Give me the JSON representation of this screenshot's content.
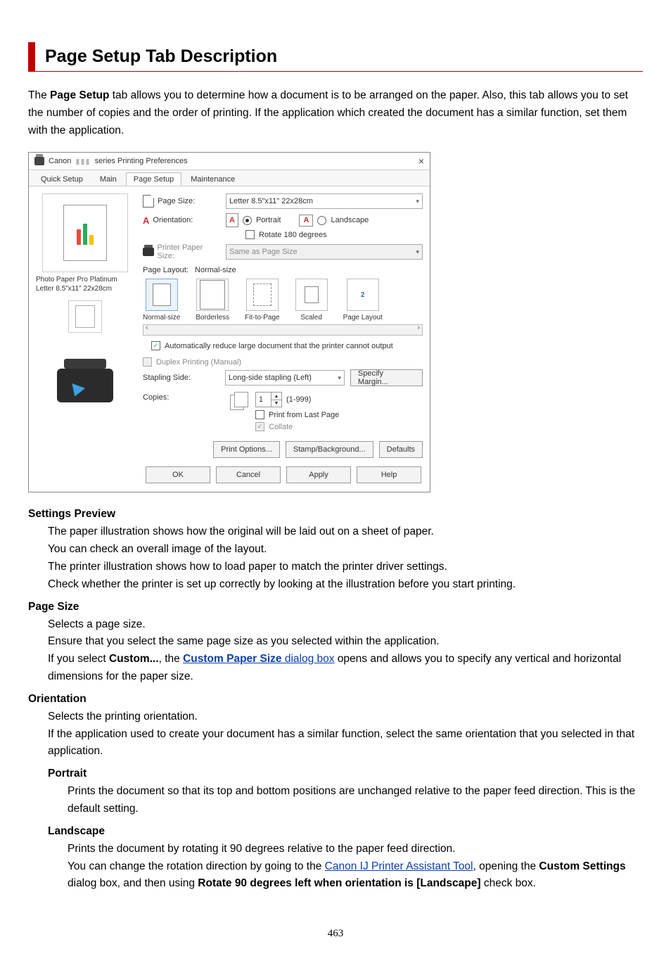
{
  "heading": "Page Setup Tab Description",
  "intro_prefix": "The ",
  "intro_bold": "Page Setup",
  "intro_rest": " tab allows you to determine how a document is to be arranged on the paper. Also, this tab allows you to set the number of copies and the order of printing. If the application which created the document has a similar function, set them with the application.",
  "dialog": {
    "title_prefix": "Canon ",
    "title_suffix": " series Printing Preferences",
    "close": "×",
    "tabs": {
      "quick": "Quick Setup",
      "main": "Main",
      "page": "Page Setup",
      "maint": "Maintenance"
    },
    "left": {
      "media1": "Photo Paper Pro Platinum",
      "media2": "Letter 8.5\"x11\" 22x28cm"
    },
    "fields": {
      "page_size_label": "Page Size:",
      "page_size_value": "Letter 8.5\"x11\" 22x28cm",
      "orientation_label": "Orientation:",
      "portrait": "Portrait",
      "landscape": "Landscape",
      "rotate180": "Rotate 180 degrees",
      "printer_paper_label": "Printer Paper Size:",
      "printer_paper_value": "Same as Page Size",
      "page_layout_label": "Page Layout:",
      "page_layout_value": "Normal-size",
      "layout_options": {
        "normal": "Normal-size",
        "borderless": "Borderless",
        "fit": "Fit-to-Page",
        "scaled": "Scaled",
        "pagelayout": "Page Layout"
      },
      "auto_reduce": "Automatically reduce large document that the printer cannot output",
      "duplex": "Duplex Printing (Manual)",
      "stapling_label": "Stapling Side:",
      "stapling_value": "Long-side stapling (Left)",
      "specify_margin": "Specify Margin...",
      "copies_label": "Copies:",
      "copies_value": "1",
      "copies_range": "(1-999)",
      "print_last": "Print from Last Page",
      "collate": "Collate",
      "print_options": "Print Options...",
      "stamp_bg": "Stamp/Background...",
      "defaults": "Defaults"
    },
    "footer": {
      "ok": "OK",
      "cancel": "Cancel",
      "apply": "Apply",
      "help": "Help"
    }
  },
  "defs": {
    "settings_preview": {
      "term": "Settings Preview",
      "l1": "The paper illustration shows how the original will be laid out on a sheet of paper.",
      "l2": "You can check an overall image of the layout.",
      "l3": "The printer illustration shows how to load paper to match the printer driver settings.",
      "l4": "Check whether the printer is set up correctly by looking at the illustration before you start printing."
    },
    "page_size": {
      "term": "Page Size",
      "l1": "Selects a page size.",
      "l2": "Ensure that you select the same page size as you selected within the application.",
      "l3a": "If you select ",
      "l3_custom": "Custom...",
      "l3_mid": ", the ",
      "l3_link1": "Custom Paper Size",
      "l3_link2": " dialog box",
      "l3b": " opens and allows you to specify any vertical and horizontal dimensions for the paper size."
    },
    "orientation": {
      "term": "Orientation",
      "l1": "Selects the printing orientation.",
      "l2": "If the application used to create your document has a similar function, select the same orientation that you selected in that application.",
      "portrait": {
        "term": "Portrait",
        "l1": "Prints the document so that its top and bottom positions are unchanged relative to the paper feed direction. This is the default setting."
      },
      "landscape": {
        "term": "Landscape",
        "l1": "Prints the document by rotating it 90 degrees relative to the paper feed direction.",
        "l2a": "You can change the rotation direction by going to the ",
        "l2_link": "Canon IJ Printer Assistant Tool",
        "l2b": ", opening the ",
        "l2_bold1": "Custom Settings",
        "l2c": " dialog box, and then using ",
        "l2_bold2": "Rotate 90 degrees left when orientation is [Landscape]",
        "l2d": " check box."
      }
    }
  },
  "pagenum": "463"
}
